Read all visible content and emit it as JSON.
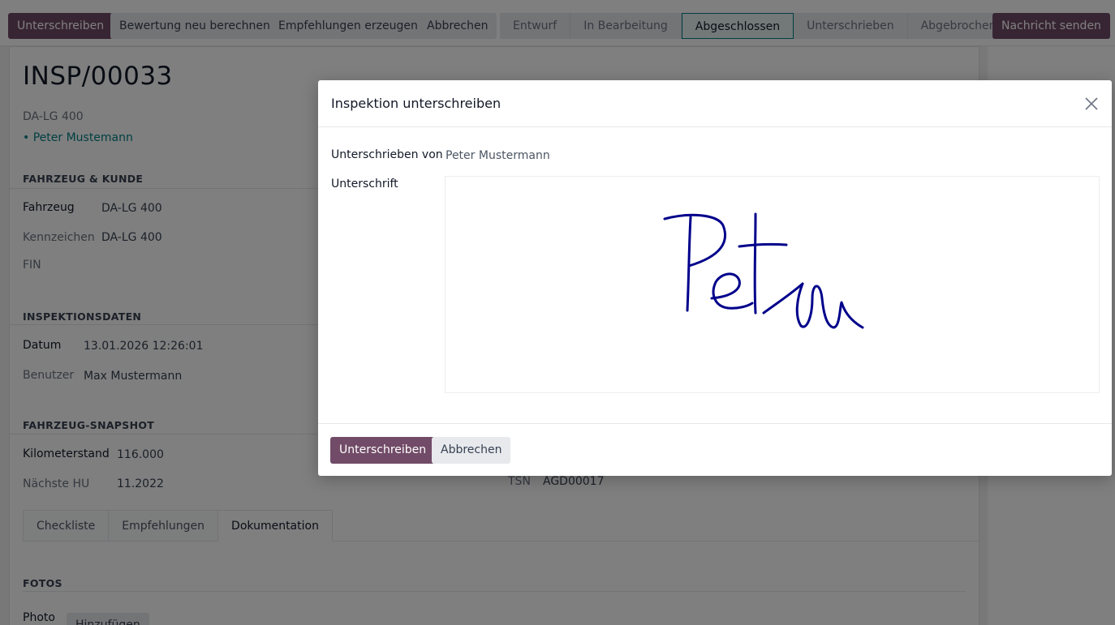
{
  "control_panel": {
    "sign_button": "Unterschreiben",
    "recalculate_button": "Bewertung neu berechnen",
    "recommendations_button": "Empfehlungen erzeugen",
    "cancel_button": "Abbrechen",
    "send_message_button": "Nachricht senden",
    "stages": [
      "Entwurf",
      "In Bearbeitung",
      "Abgeschlossen",
      "Unterschrieben",
      "Abgebrochen"
    ],
    "current_stage": "Abgeschlossen"
  },
  "record": {
    "title": "INSP/00033",
    "vehicle_subtitle": "DA-LG 400",
    "customer_subtitle": "• Peter Mustemann"
  },
  "sections": {
    "vehicle_customer": {
      "title": "FAHRZEUG & KUNDE",
      "vehicle_label": "Fahrzeug",
      "vehicle_value": "DA-LG 400",
      "plate_label": "Kennzeichen",
      "plate_value": "DA-LG 400",
      "vin_label": "FIN"
    },
    "inspection_data": {
      "title": "INSPEKTIONSDATEN",
      "date_label": "Datum",
      "date_value": "13.01.2026 12:26:01",
      "user_label": "Benutzer",
      "user_value": "Max Mustermann"
    },
    "snapshot": {
      "title": "FAHRZEUG-SNAPSHOT",
      "mileage_label": "Kilometerstand",
      "mileage_value": "116.000",
      "next_hu_label": "Nächste HU",
      "next_hu_value": "11.2022",
      "tsn_label": "TSN",
      "tsn_value": "AGD00017"
    }
  },
  "tabs": [
    "Checkliste",
    "Empfehlungen",
    "Dokumentation"
  ],
  "active_tab": "Dokumentation",
  "photos": {
    "title": "FOTOS",
    "photo_label": "Photo",
    "add_button": "Hinzufügen"
  },
  "dialog": {
    "title": "Inspektion unterschreiben",
    "signed_by_label": "Unterschrieben von",
    "signed_by_value": "Peter Mustermann",
    "signature_label": "Unterschrift",
    "signature_text": "Peter",
    "confirm_button": "Unterschreiben",
    "cancel_button": "Abbrechen"
  },
  "colors": {
    "primary": "#714b67",
    "accent_link": "#017e84",
    "signature_ink": "#00008b"
  }
}
